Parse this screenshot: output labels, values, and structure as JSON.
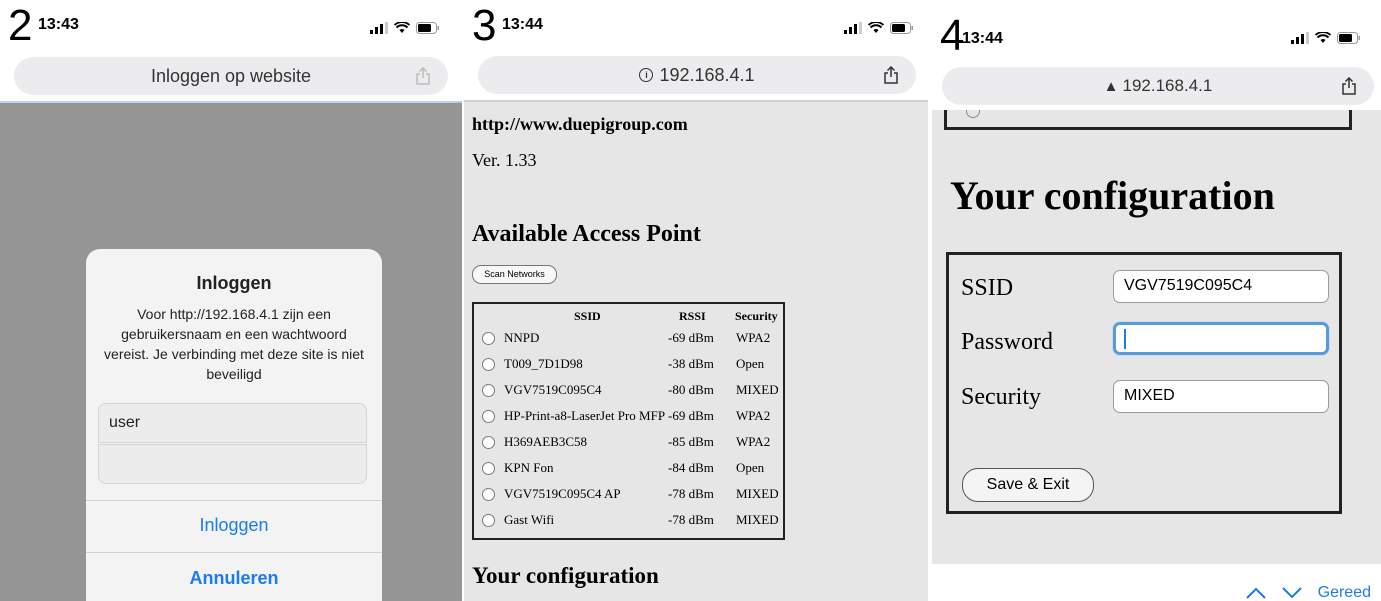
{
  "panels": {
    "p2": {
      "step": "2",
      "time": "13:43",
      "url_text": "Inloggen op website",
      "dialog": {
        "title": "Inloggen",
        "message": "Voor http://192.168.4.1 zijn een gebruikersnaam en een wachtwoord vereist. Je verbinding met deze site is niet beveiligd",
        "username_value": "user",
        "password_value": "",
        "login_button": "Inloggen",
        "cancel_button": "Annuleren"
      }
    },
    "p3": {
      "step": "3",
      "time": "13:44",
      "url_text": "192.168.4.1",
      "site": "http://www.duepigroup.com",
      "version": "Ver. 1.33",
      "ap_heading": "Available Access Point",
      "scan_button": "Scan Networks",
      "table_headers": {
        "ssid": "SSID",
        "rssi": "RSSI",
        "security": "Security"
      },
      "networks": [
        {
          "ssid": "NNPD",
          "rssi": "-69 dBm",
          "security": "WPA2"
        },
        {
          "ssid": "T009_7D1D98",
          "rssi": "-38 dBm",
          "security": "Open"
        },
        {
          "ssid": "VGV7519C095C4",
          "rssi": "-80 dBm",
          "security": "MIXED"
        },
        {
          "ssid": "HP-Print-a8-LaserJet Pro MFP",
          "rssi": "-69 dBm",
          "security": "WPA2"
        },
        {
          "ssid": "H369AEB3C58",
          "rssi": "-85 dBm",
          "security": "WPA2"
        },
        {
          "ssid": "KPN Fon",
          "rssi": "-84 dBm",
          "security": "Open"
        },
        {
          "ssid": "VGV7519C095C4 AP",
          "rssi": "-78 dBm",
          "security": "MIXED"
        },
        {
          "ssid": "Gast Wifi",
          "rssi": "-78 dBm",
          "security": "MIXED"
        }
      ],
      "config_heading": "Your configuration"
    },
    "p4": {
      "step": "4",
      "time": "13:44",
      "url_text": "192.168.4.1",
      "config_heading": "Your configuration",
      "ssid_label": "SSID",
      "ssid_value": "VGV7519C095C4",
      "password_label": "Password",
      "password_value": "",
      "security_label": "Security",
      "security_value": "MIXED",
      "save_button": "Save & Exit",
      "done_label": "Gereed"
    }
  },
  "colors": {
    "ios_blue": "#1b7cf2",
    "overlay_gray": "#959595",
    "page_gray": "#e6e6e6"
  }
}
